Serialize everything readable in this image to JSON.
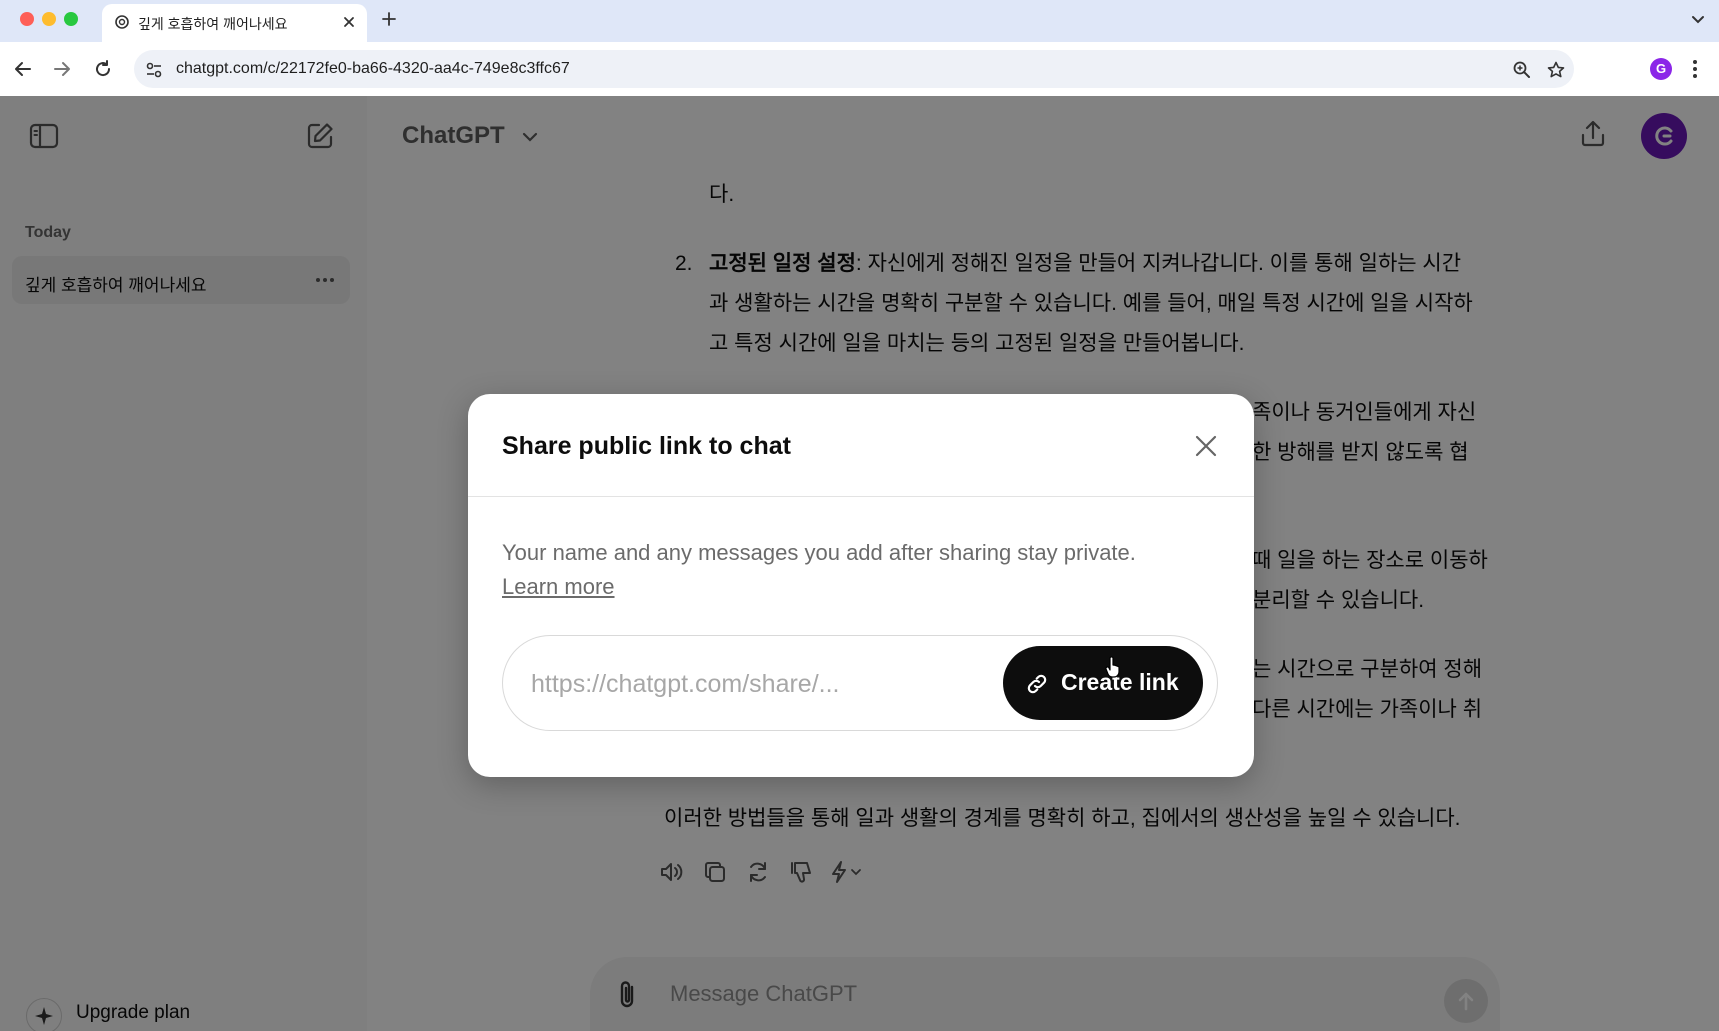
{
  "browser": {
    "tab_title": "깊게 호흡하여 깨어나세요",
    "url": "chatgpt.com/c/22172fe0-ba66-4320-aa4c-749e8c3ffc67",
    "profile_initial": "G",
    "traffic_colors": [
      "#fe5f57",
      "#febc2e",
      "#28c840"
    ]
  },
  "sidebar": {
    "section_label": "Today",
    "chats": [
      {
        "title": "깊게 호흡하여 깨어나세요"
      }
    ],
    "upgrade_label": "Upgrade plan"
  },
  "header": {
    "model_name": "ChatGPT"
  },
  "conversation": {
    "line_da": "다.",
    "item2_number": "2.",
    "item2_bold": "고정된 일정 설정",
    "item2_line1_rest": ": 자신에게 정해진 일정을 만들어 지켜나갑니다. 이를 통해 일하는 시간",
    "item2_line2": "과 생활하는 시간을 명확히 구분할 수 있습니다. 예를 들어, 매일 특정 시간에 일을 시작하",
    "item2_line3": "고 특정 시간에 일을 마치는 등의 고정된 일정을 만들어봅니다.",
    "partial_a1": "족이나 동거인들에게 자신",
    "partial_a2": "한 방해를 받지 않도록 협",
    "partial_b1": "때 일을 하는 장소로 이동하",
    "partial_b2": "분리할 수 있습니다.",
    "partial_c1": "는 시간으로 구분하여 정해",
    "partial_c2": "다른 시간에는 가족이나 취",
    "conclusion": "이러한 방법들을 통해 일과 생활의 경계를 명확히 하고, 집에서의 생산성을 높일 수 있습니다."
  },
  "composer": {
    "placeholder": "Message ChatGPT"
  },
  "modal": {
    "title": "Share public link to chat",
    "description": "Your name and any messages you add after sharing stay private.",
    "learn_more": "Learn more",
    "link_placeholder": "https://chatgpt.com/share/...",
    "create_button": "Create link"
  },
  "colors": {
    "avatar": "#6a19b8",
    "overlay_alpha": 0.49,
    "primary_button": "#0d0d0d"
  }
}
